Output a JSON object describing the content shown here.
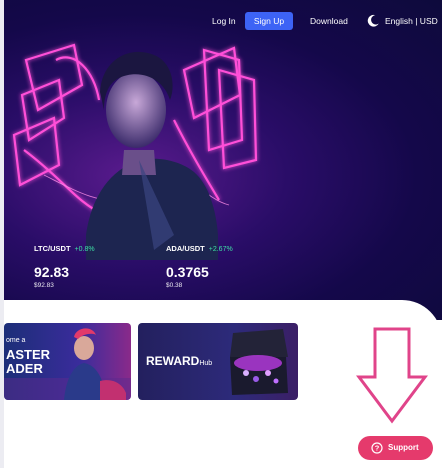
{
  "nav": {
    "login": "Log In",
    "signup": "Sign Up",
    "download": "Download",
    "theme_icon": "moon-icon",
    "lang_currency": "English | USD"
  },
  "tickers": [
    {
      "pair": "LTC/USDT",
      "change": "+0.8%",
      "price": "92.83",
      "sub": "$92.83"
    },
    {
      "pair": "ADA/USDT",
      "change": "+2.67%",
      "price": "0.3765",
      "sub": "$0.38"
    }
  ],
  "cards": {
    "card1_line1": "ome a",
    "card1_line2": "ASTER",
    "card1_line3": "ADER",
    "card2_title": "REWARD",
    "card2_sub": "Hub"
  },
  "support": {
    "label": "Support",
    "icon": "question-icon"
  },
  "colors": {
    "accent": "#3d63f5",
    "support": "#e53a6c",
    "positive": "#3fe0a6",
    "arrow": "#e0448a"
  }
}
